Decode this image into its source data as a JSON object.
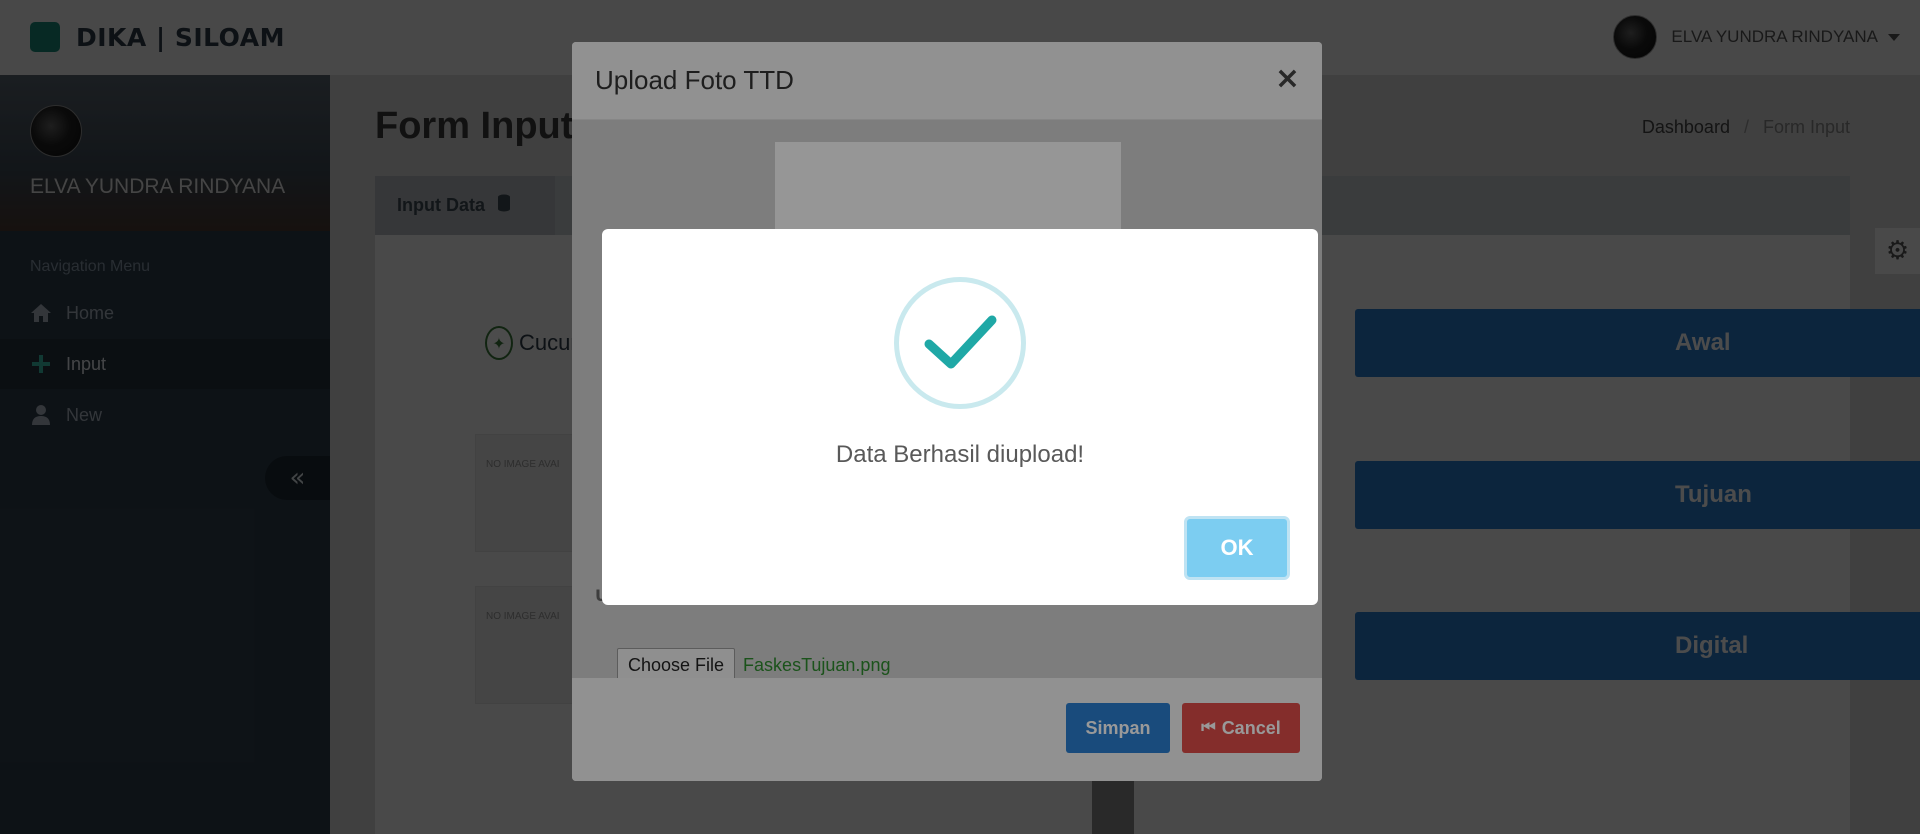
{
  "app": {
    "brand": "DIKA | SILOAM",
    "user_name": "ELVA YUNDRA RINDYANA"
  },
  "sidebar": {
    "profile_name": "ELVA YUNDRA RINDYANA",
    "nav_header": "Navigation Menu",
    "items": [
      {
        "label": "Home",
        "icon": "home-icon"
      },
      {
        "label": "Input",
        "icon": "plus-icon",
        "active": true
      },
      {
        "label": "New",
        "icon": "user-icon"
      }
    ],
    "collapse_icon": "«"
  },
  "main": {
    "page_title": "Form Input",
    "breadcrumb": {
      "home": "Dashboard",
      "current": "Form Input"
    },
    "tab_label": "Input Data",
    "logo_text": "Cucun",
    "no_image_text": "NO IMAGE AVAI",
    "buttons": [
      "Awal",
      "Tujuan",
      "Digital"
    ]
  },
  "modal": {
    "title": "Upload Foto TTD",
    "close_label": "×",
    "upload_label_partial": "U",
    "file_button": "Choose File",
    "file_name": "FaskesTujuan.png",
    "save_label": "Simpan",
    "cancel_label": "Cancel"
  },
  "alert": {
    "message": "Data Berhasil diupload!",
    "ok_label": "OK"
  },
  "colors": {
    "primary": "#2b7dcf",
    "danger": "#dd4b48",
    "success_check": "#1fa8a6",
    "ok_button": "#7ccdf1",
    "sidebar": "#2e3e4c"
  }
}
